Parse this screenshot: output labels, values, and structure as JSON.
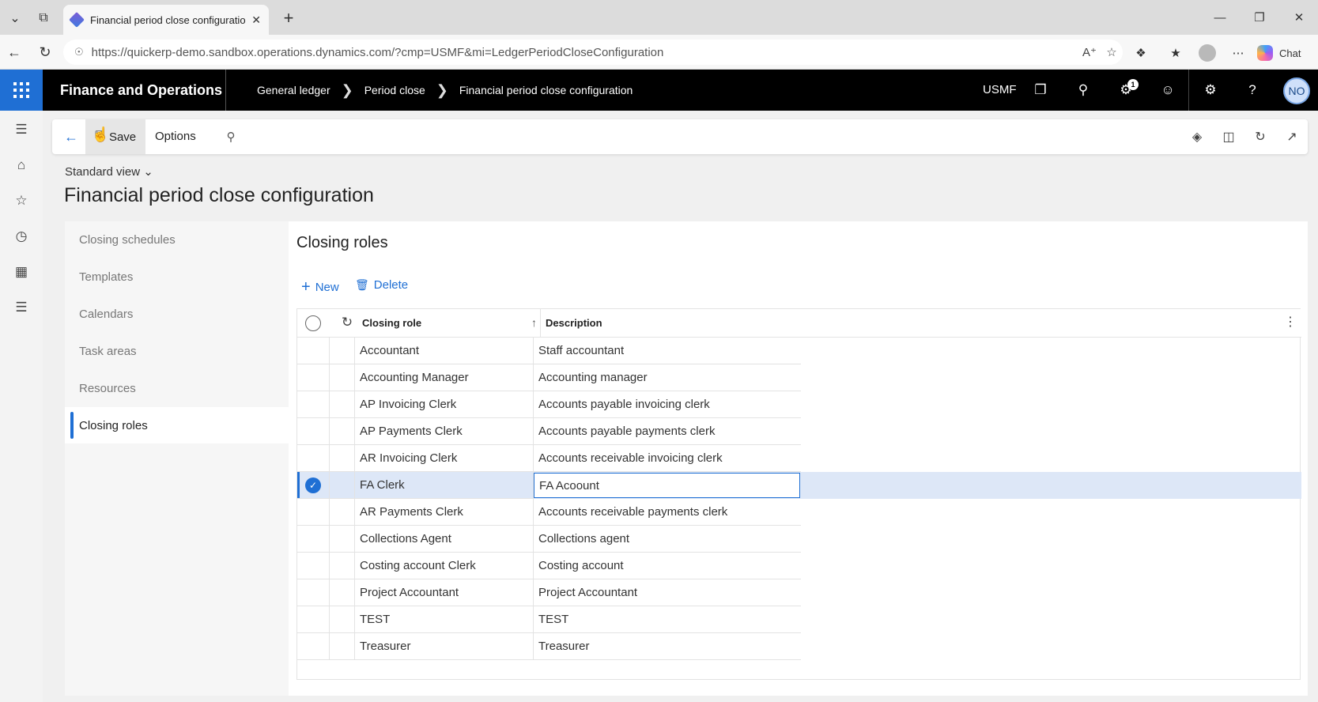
{
  "browser": {
    "tab_title": "Financial period close configuratio",
    "url": "https://quickerp-demo.sandbox.operations.dynamics.com/?cmp=USMF&mi=LedgerPeriodCloseConfiguration",
    "chat_label": "Chat"
  },
  "app": {
    "title": "Finance and Operations",
    "breadcrumbs": [
      "General ledger",
      "Period close",
      "Financial period close configuration"
    ],
    "company": "USMF",
    "notification_count": "1",
    "user_initials": "NO"
  },
  "actions": {
    "save_label": "Save",
    "options_label": "Options"
  },
  "page": {
    "view_label": "Standard view",
    "title": "Financial period close configuration"
  },
  "leftnav": {
    "items": [
      {
        "label": "Closing schedules"
      },
      {
        "label": "Templates"
      },
      {
        "label": "Calendars"
      },
      {
        "label": "Task areas"
      },
      {
        "label": "Resources"
      },
      {
        "label": "Closing roles"
      }
    ],
    "active_index": 5
  },
  "panel": {
    "title": "Closing roles",
    "new_label": "New",
    "delete_label": "Delete"
  },
  "grid": {
    "columns": {
      "role": "Closing role",
      "description": "Description"
    },
    "rows": [
      {
        "role": "Accountant",
        "description": "Staff accountant"
      },
      {
        "role": "Accounting Manager",
        "description": "Accounting manager"
      },
      {
        "role": "AP Invoicing Clerk",
        "description": "Accounts payable invoicing clerk"
      },
      {
        "role": "AP Payments Clerk",
        "description": "Accounts payable payments clerk"
      },
      {
        "role": "AR Invoicing Clerk",
        "description": "Accounts receivable invoicing clerk"
      },
      {
        "role": "FA Clerk",
        "description": "FA Acoount"
      },
      {
        "role": "AR Payments Clerk",
        "description": "Accounts receivable payments clerk"
      },
      {
        "role": "Collections Agent",
        "description": "Collections agent"
      },
      {
        "role": "Costing account Clerk",
        "description": "Costing account"
      },
      {
        "role": "Project Accountant",
        "description": "Project Accountant"
      },
      {
        "role": "TEST",
        "description": "TEST"
      },
      {
        "role": "Treasurer",
        "description": "Treasurer"
      }
    ],
    "selected_index": 5
  },
  "colors": {
    "accent": "#1f6fd4",
    "header_bg": "#000000",
    "selected_row": "#dde7f7"
  }
}
